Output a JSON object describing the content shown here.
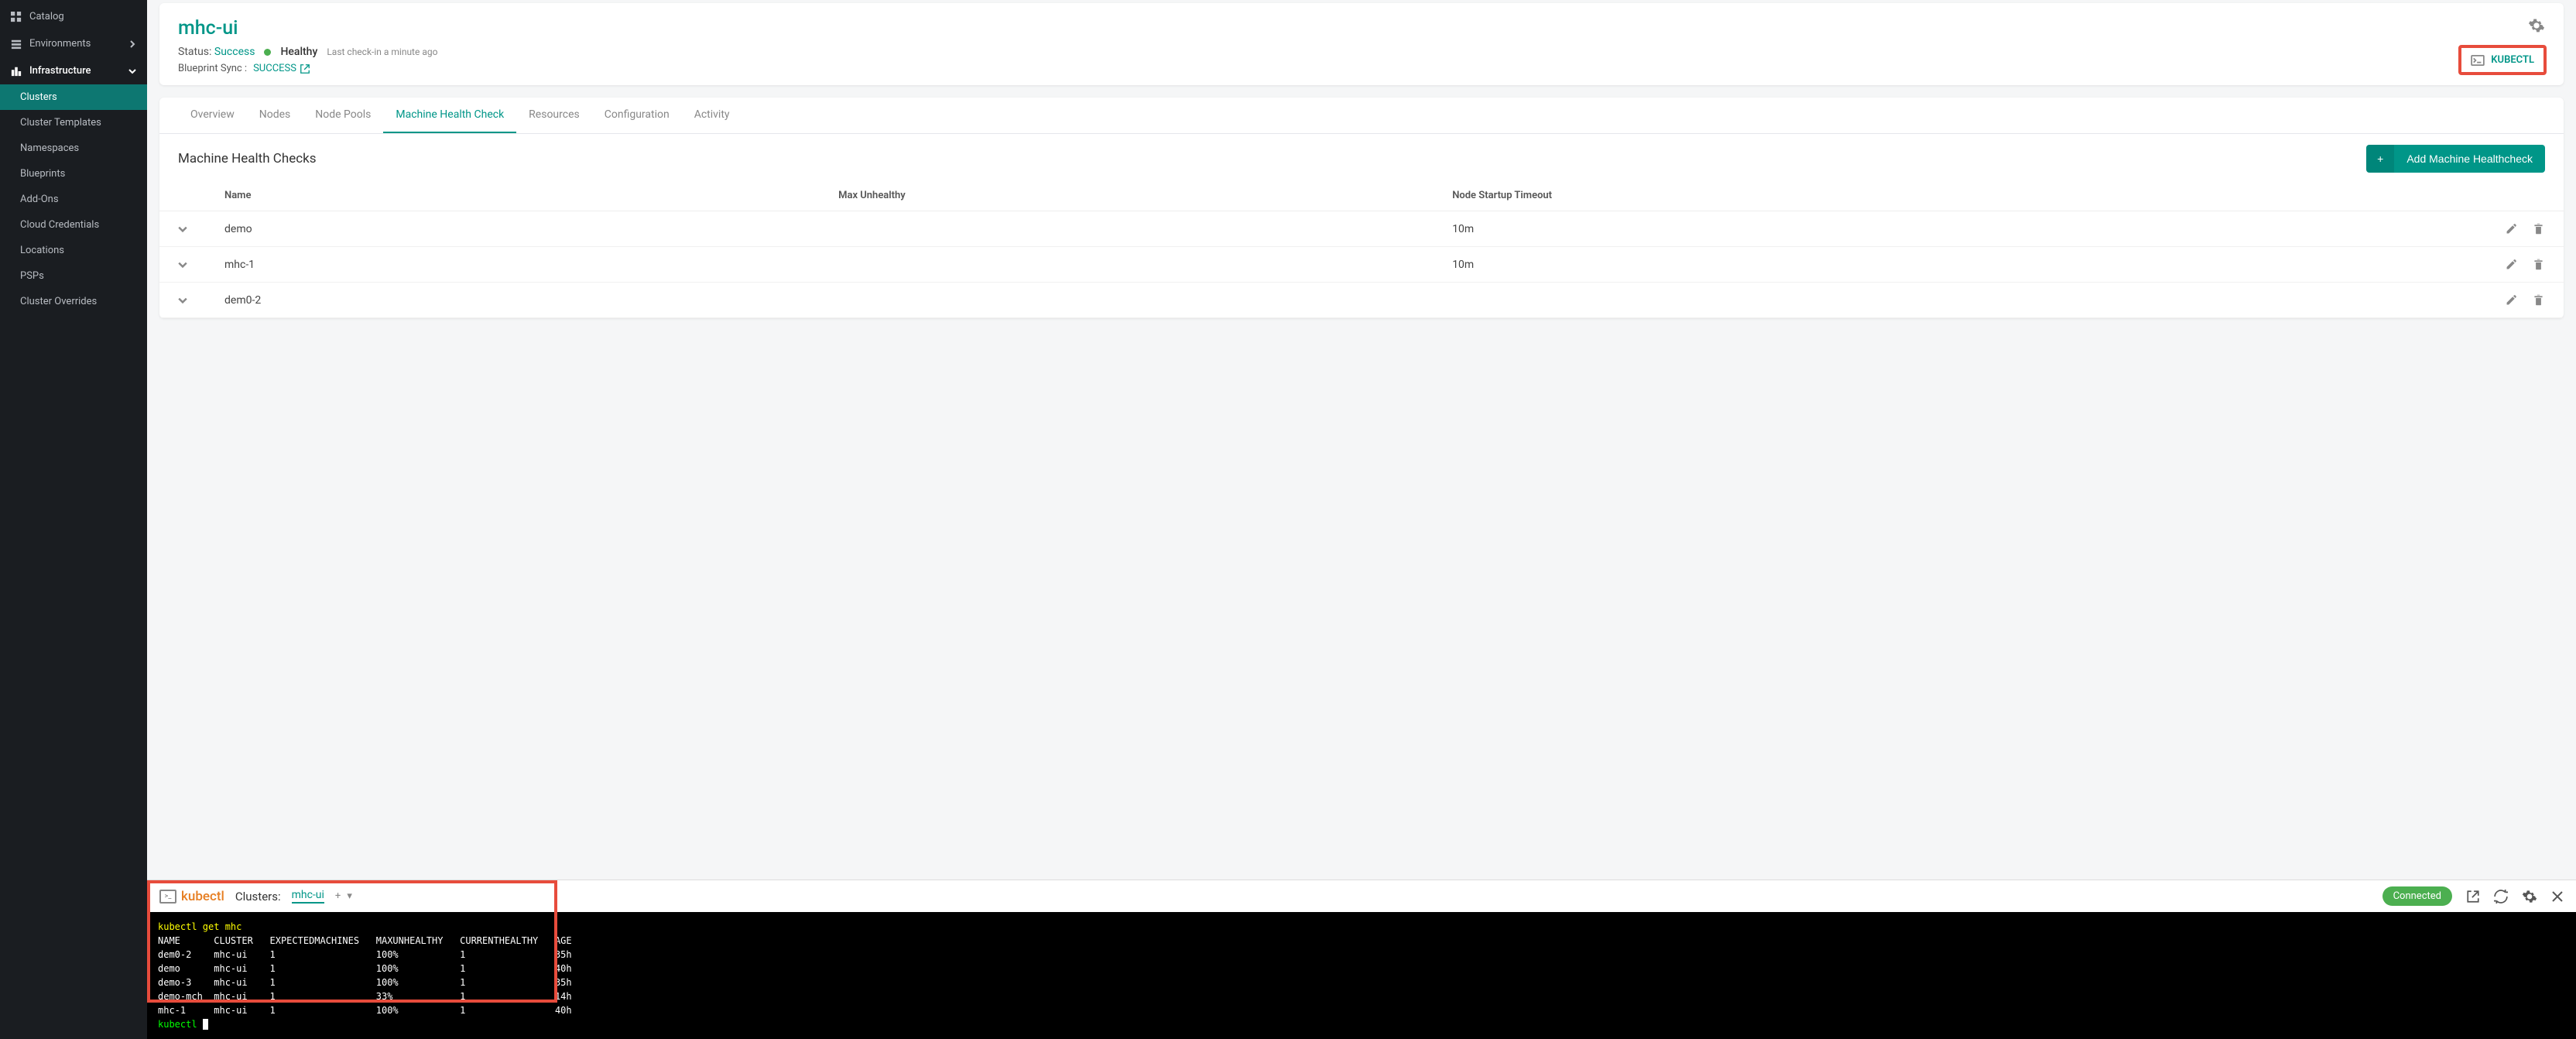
{
  "sidebar": {
    "items": [
      {
        "label": "Catalog",
        "icon": "grid"
      },
      {
        "label": "Environments",
        "icon": "layers",
        "chevron": "right"
      },
      {
        "label": "Infrastructure",
        "icon": "city",
        "chevron": "down",
        "expanded": true
      },
      {
        "label": "Clusters",
        "sub": true,
        "active": true
      },
      {
        "label": "Cluster Templates",
        "sub": true
      },
      {
        "label": "Namespaces",
        "sub": true
      },
      {
        "label": "Blueprints",
        "sub": true
      },
      {
        "label": "Add-Ons",
        "sub": true
      },
      {
        "label": "Cloud Credentials",
        "sub": true
      },
      {
        "label": "Locations",
        "sub": true
      },
      {
        "label": "PSPs",
        "sub": true
      },
      {
        "label": "Cluster Overrides",
        "sub": true
      }
    ]
  },
  "header": {
    "title": "mhc-ui",
    "status_label": "Status:",
    "status_value": "Success",
    "health_text": "Healthy",
    "checkin": "Last check-in a minute ago",
    "blueprint_label": "Blueprint Sync :",
    "blueprint_value": "SUCCESS",
    "kubectl_btn": "KUBECTL"
  },
  "tabs": [
    {
      "label": "Overview"
    },
    {
      "label": "Nodes"
    },
    {
      "label": "Node Pools"
    },
    {
      "label": "Machine Health Check",
      "active": true
    },
    {
      "label": "Resources"
    },
    {
      "label": "Configuration"
    },
    {
      "label": "Activity"
    }
  ],
  "mhc": {
    "section_title": "Machine Health Checks",
    "add_btn": "Add Machine Healthcheck",
    "columns": {
      "name": "Name",
      "max": "Max Unhealthy",
      "timeout": "Node Startup Timeout"
    },
    "rows": [
      {
        "name": "demo",
        "max": "",
        "timeout": "10m"
      },
      {
        "name": "mhc-1",
        "max": "",
        "timeout": "10m"
      },
      {
        "name": "dem0-2",
        "max": "",
        "timeout": ""
      }
    ]
  },
  "terminal": {
    "logo": "kubectl",
    "clusters_label": "Clusters:",
    "cluster": "mhc-ui",
    "connected": "Connected",
    "command": "kubectl get mhc",
    "headers": "NAME      CLUSTER   EXPECTEDMACHINES   MAXUNHEALTHY   CURRENTHEALTHY   AGE",
    "rows": [
      "dem0-2    mhc-ui    1                  100%           1                35h",
      "demo      mhc-ui    1                  100%           1                40h",
      "demo-3    mhc-ui    1                  100%           1                35h",
      "demo-mch  mhc-ui    1                  33%            1                14h",
      "mhc-1     mhc-ui    1                  100%           1                40h"
    ],
    "prompt": "kubectl "
  }
}
